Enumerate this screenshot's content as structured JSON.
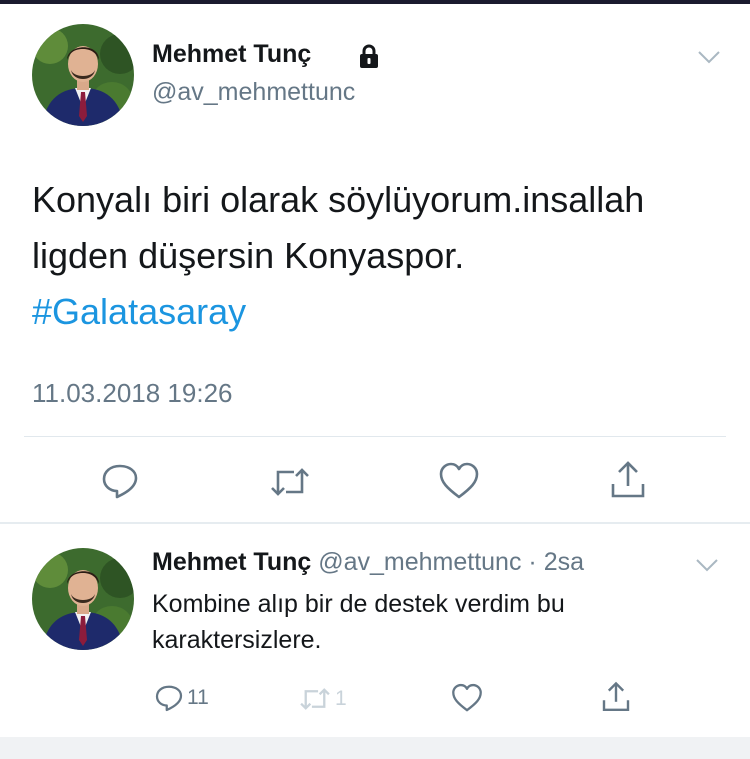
{
  "tweet": {
    "author_name": "Mehmet Tunç",
    "author_handle": "@av_mehmettunc",
    "text_line1": "Konyalı biri olarak söylüyorum.insallah",
    "text_line2": "ligden düşersin Konyaspor.",
    "hashtag": "#Galatasaray",
    "timestamp": "11.03.2018 19:26",
    "protected": true
  },
  "reply": {
    "author_name": "Mehmet Tunç",
    "author_handle": "@av_mehmettunc",
    "time_ago": "2sa",
    "separator": "·",
    "text_line1": "Kombine alıp bir de destek verdim bu",
    "text_line2": "karaktersizlere.",
    "reply_count": "11",
    "retweet_count": "1"
  },
  "colors": {
    "hashtag": "#1b95e0",
    "secondary_text": "#657786",
    "icon": "#657786",
    "divider": "#e1e8ed"
  },
  "icons": [
    "lock-icon",
    "chevron-down-icon",
    "reply-icon",
    "retweet-icon",
    "like-icon",
    "share-icon"
  ]
}
